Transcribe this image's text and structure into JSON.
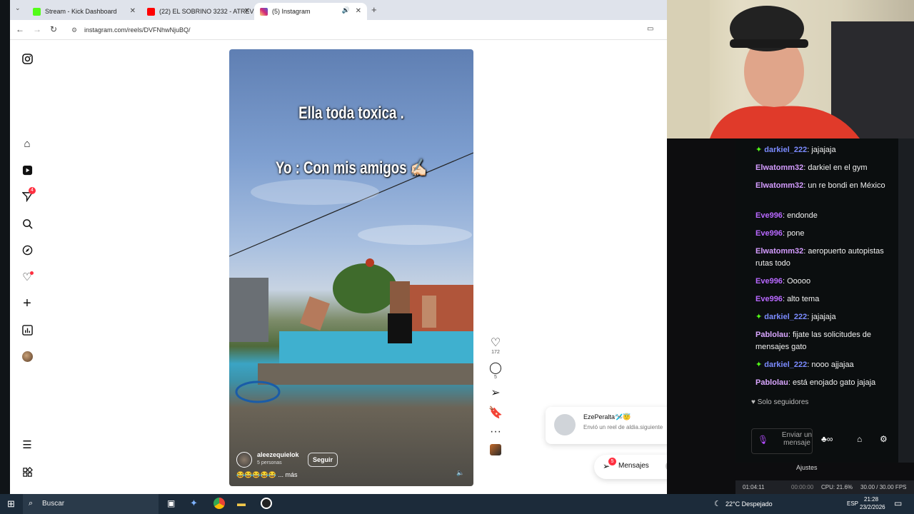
{
  "browser": {
    "tabs": [
      {
        "label": "Stream - Kick Dashboard",
        "color": "#53fc18"
      },
      {
        "label": "(22) EL SOBRINO 3232 - ATREV",
        "color": "#ff0000"
      },
      {
        "label": "(5) Instagram",
        "color": "#d62976"
      }
    ],
    "new_tab": "+",
    "url": "instagram.com/reels/DVFNhwNjuBQ/"
  },
  "instagram": {
    "sidebar_badges": {
      "notifications": "4"
    },
    "reel": {
      "caption_line1": "Ella toda toxica .",
      "caption_line2": "Yo : Con mis amigos ✍🏻",
      "username": "aleezequielok",
      "sub_label": "5 personas",
      "follow_label": "Seguir",
      "description": "😂😂😂😂😂 ... más",
      "likes": "172",
      "comments": "5"
    },
    "notification": {
      "name": "EzePeralta🛩️😇",
      "text": "Envió un reel de aldia.siguiente"
    },
    "messages": {
      "label": "Mensajes",
      "badge": "5"
    }
  },
  "chat": {
    "messages": [
      {
        "user": "darkiel_222",
        "text": "jajajaja",
        "color": "#7b8bff",
        "badge": true
      },
      {
        "user": "Elwatomm32",
        "text": "darkiel en el gym",
        "color": "#d49cff",
        "badge": false
      },
      {
        "user": "Elwatomm32",
        "text": "un re bondi en México",
        "color": "#d49cff",
        "badge": false
      },
      {
        "user": "Eve996",
        "text": "endonde",
        "color": "#b868ff",
        "badge": false
      },
      {
        "user": "Eve996",
        "text": "pone",
        "color": "#b868ff",
        "badge": false
      },
      {
        "user": "Elwatomm32",
        "text": "aeropuerto autopistas rutas todo",
        "color": "#d49cff",
        "badge": false
      },
      {
        "user": "Eve996",
        "text": "Ooooo",
        "color": "#b868ff",
        "badge": false
      },
      {
        "user": "Eve996",
        "text": "alto tema",
        "color": "#b868ff",
        "badge": false
      },
      {
        "user": "darkiel_222",
        "text": "jajajaja",
        "color": "#7b8bff",
        "badge": true
      },
      {
        "user": "Pablolau",
        "text": "fijate las solicitudes de mensajes gato",
        "color": "#d9a6ff",
        "badge": false
      },
      {
        "user": "darkiel_222",
        "text": "nooo ajjajaa",
        "color": "#7b8bff",
        "badge": true
      },
      {
        "user": "Pablolau",
        "text": "está enojado gato jajaja",
        "color": "#d9a6ff",
        "badge": false
      }
    ],
    "followers_only": "Solo seguidores",
    "input_placeholder": "Enviar un mensaje",
    "settings_label": "Ajustes"
  },
  "obs": {
    "time": "01:04:11",
    "rec": "00:00:00",
    "cpu": "CPU: 21.6%",
    "fps": "30.00 / 30.00 FPS"
  },
  "taskbar": {
    "search": "Buscar",
    "weather": "22°C Despejado",
    "lang": "ESP",
    "time": "21:28",
    "date": "23/2/2026"
  }
}
